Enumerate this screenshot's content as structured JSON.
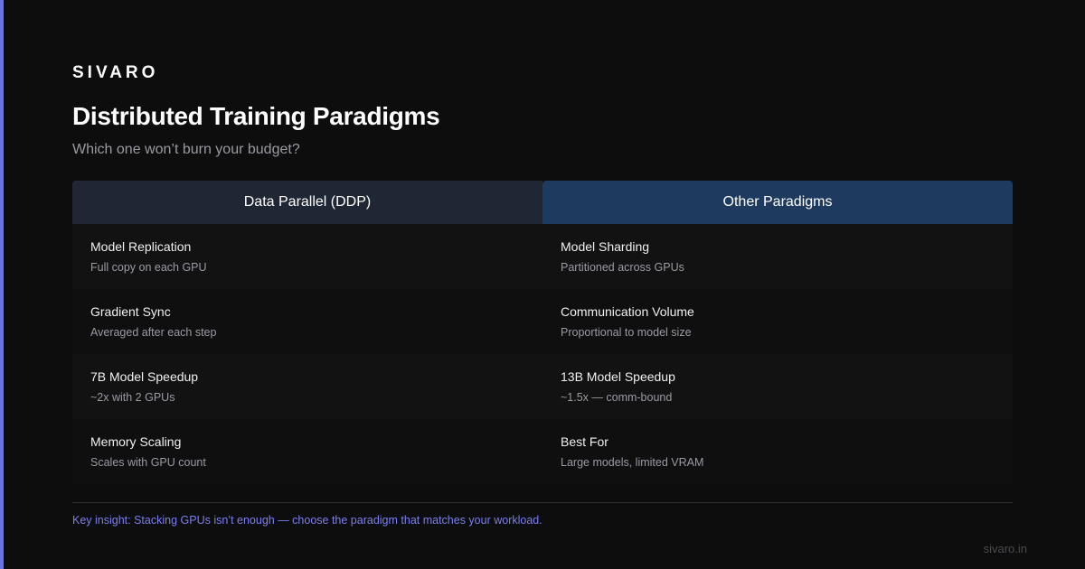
{
  "colors": {
    "accent": "#6b72e6",
    "insight": "#7b7ff0",
    "background": "#0d0d0e"
  },
  "brand": "SIVARO",
  "title": "Distributed Training Paradigms",
  "subtitle": "Which one won’t burn your budget?",
  "table": {
    "headers": [
      "Data Parallel (DDP)",
      "Other Paradigms"
    ],
    "rows": [
      {
        "left": {
          "label": "Model Replication",
          "desc": "Full copy on each GPU"
        },
        "right": {
          "label": "Model Sharding",
          "desc": "Partitioned across GPUs"
        }
      },
      {
        "left": {
          "label": "Gradient Sync",
          "desc": "Averaged after each step"
        },
        "right": {
          "label": "Communication Volume",
          "desc": "Proportional to model size"
        }
      },
      {
        "left": {
          "label": "7B Model Speedup",
          "desc": "~2x with 2 GPUs"
        },
        "right": {
          "label": "13B Model Speedup",
          "desc": "~1.5x — comm-bound"
        }
      },
      {
        "left": {
          "label": "Memory Scaling",
          "desc": "Scales with GPU count"
        },
        "right": {
          "label": "Best For",
          "desc": "Large models, limited VRAM"
        }
      }
    ]
  },
  "insight": "Key insight: Stacking GPUs isn’t enough — choose the paradigm that matches your workload.",
  "site": "sivaro.in"
}
